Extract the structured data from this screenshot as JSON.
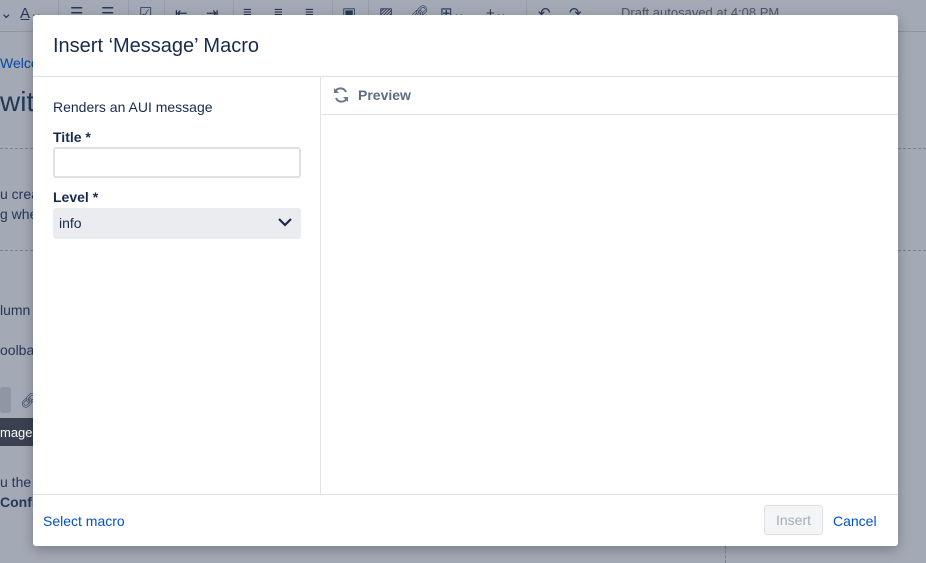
{
  "toolbar": {
    "status": "Draft autosaved at 4:08 PM"
  },
  "background": {
    "fragments": [
      "Welco",
      "with",
      "u crea",
      "g whe",
      "lumn",
      "oolba",
      "mage",
      "u the",
      "Confl"
    ]
  },
  "dialog": {
    "title": "Insert ‘Message’ Macro",
    "description": "Renders an AUI message",
    "title_label": "Title *",
    "title_value": "",
    "level_label": "Level *",
    "level_value": "info",
    "preview_label": "Preview",
    "select_macro": "Select macro",
    "insert": "Insert",
    "cancel": "Cancel"
  }
}
